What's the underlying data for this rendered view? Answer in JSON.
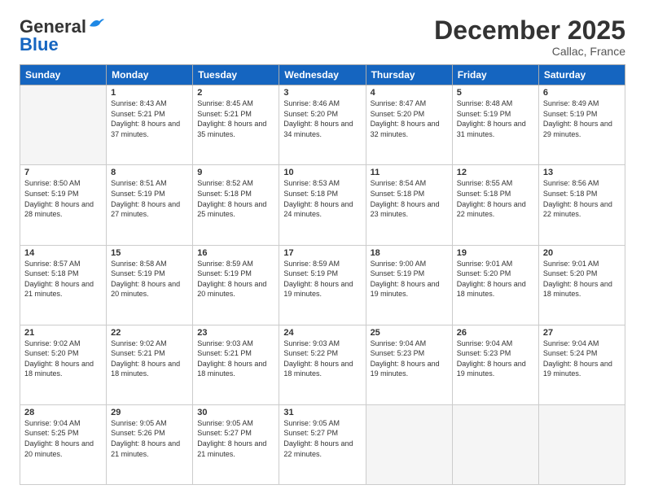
{
  "logo": {
    "line1": "General",
    "line2": "Blue"
  },
  "title": "December 2025",
  "location": "Callac, France",
  "days_header": [
    "Sunday",
    "Monday",
    "Tuesday",
    "Wednesday",
    "Thursday",
    "Friday",
    "Saturday"
  ],
  "weeks": [
    [
      {
        "num": "",
        "empty": true
      },
      {
        "num": "1",
        "sunrise": "8:43 AM",
        "sunset": "5:21 PM",
        "daylight": "8 hours and 37 minutes."
      },
      {
        "num": "2",
        "sunrise": "8:45 AM",
        "sunset": "5:21 PM",
        "daylight": "8 hours and 35 minutes."
      },
      {
        "num": "3",
        "sunrise": "8:46 AM",
        "sunset": "5:20 PM",
        "daylight": "8 hours and 34 minutes."
      },
      {
        "num": "4",
        "sunrise": "8:47 AM",
        "sunset": "5:20 PM",
        "daylight": "8 hours and 32 minutes."
      },
      {
        "num": "5",
        "sunrise": "8:48 AM",
        "sunset": "5:19 PM",
        "daylight": "8 hours and 31 minutes."
      },
      {
        "num": "6",
        "sunrise": "8:49 AM",
        "sunset": "5:19 PM",
        "daylight": "8 hours and 29 minutes."
      }
    ],
    [
      {
        "num": "7",
        "sunrise": "8:50 AM",
        "sunset": "5:19 PM",
        "daylight": "8 hours and 28 minutes."
      },
      {
        "num": "8",
        "sunrise": "8:51 AM",
        "sunset": "5:19 PM",
        "daylight": "8 hours and 27 minutes."
      },
      {
        "num": "9",
        "sunrise": "8:52 AM",
        "sunset": "5:18 PM",
        "daylight": "8 hours and 25 minutes."
      },
      {
        "num": "10",
        "sunrise": "8:53 AM",
        "sunset": "5:18 PM",
        "daylight": "8 hours and 24 minutes."
      },
      {
        "num": "11",
        "sunrise": "8:54 AM",
        "sunset": "5:18 PM",
        "daylight": "8 hours and 23 minutes."
      },
      {
        "num": "12",
        "sunrise": "8:55 AM",
        "sunset": "5:18 PM",
        "daylight": "8 hours and 22 minutes."
      },
      {
        "num": "13",
        "sunrise": "8:56 AM",
        "sunset": "5:18 PM",
        "daylight": "8 hours and 22 minutes."
      }
    ],
    [
      {
        "num": "14",
        "sunrise": "8:57 AM",
        "sunset": "5:18 PM",
        "daylight": "8 hours and 21 minutes."
      },
      {
        "num": "15",
        "sunrise": "8:58 AM",
        "sunset": "5:19 PM",
        "daylight": "8 hours and 20 minutes."
      },
      {
        "num": "16",
        "sunrise": "8:59 AM",
        "sunset": "5:19 PM",
        "daylight": "8 hours and 20 minutes."
      },
      {
        "num": "17",
        "sunrise": "8:59 AM",
        "sunset": "5:19 PM",
        "daylight": "8 hours and 19 minutes."
      },
      {
        "num": "18",
        "sunrise": "9:00 AM",
        "sunset": "5:19 PM",
        "daylight": "8 hours and 19 minutes."
      },
      {
        "num": "19",
        "sunrise": "9:01 AM",
        "sunset": "5:20 PM",
        "daylight": "8 hours and 18 minutes."
      },
      {
        "num": "20",
        "sunrise": "9:01 AM",
        "sunset": "5:20 PM",
        "daylight": "8 hours and 18 minutes."
      }
    ],
    [
      {
        "num": "21",
        "sunrise": "9:02 AM",
        "sunset": "5:20 PM",
        "daylight": "8 hours and 18 minutes."
      },
      {
        "num": "22",
        "sunrise": "9:02 AM",
        "sunset": "5:21 PM",
        "daylight": "8 hours and 18 minutes."
      },
      {
        "num": "23",
        "sunrise": "9:03 AM",
        "sunset": "5:21 PM",
        "daylight": "8 hours and 18 minutes."
      },
      {
        "num": "24",
        "sunrise": "9:03 AM",
        "sunset": "5:22 PM",
        "daylight": "8 hours and 18 minutes."
      },
      {
        "num": "25",
        "sunrise": "9:04 AM",
        "sunset": "5:23 PM",
        "daylight": "8 hours and 19 minutes."
      },
      {
        "num": "26",
        "sunrise": "9:04 AM",
        "sunset": "5:23 PM",
        "daylight": "8 hours and 19 minutes."
      },
      {
        "num": "27",
        "sunrise": "9:04 AM",
        "sunset": "5:24 PM",
        "daylight": "8 hours and 19 minutes."
      }
    ],
    [
      {
        "num": "28",
        "sunrise": "9:04 AM",
        "sunset": "5:25 PM",
        "daylight": "8 hours and 20 minutes."
      },
      {
        "num": "29",
        "sunrise": "9:05 AM",
        "sunset": "5:26 PM",
        "daylight": "8 hours and 21 minutes."
      },
      {
        "num": "30",
        "sunrise": "9:05 AM",
        "sunset": "5:27 PM",
        "daylight": "8 hours and 21 minutes."
      },
      {
        "num": "31",
        "sunrise": "9:05 AM",
        "sunset": "5:27 PM",
        "daylight": "8 hours and 22 minutes."
      },
      {
        "num": "",
        "empty": true
      },
      {
        "num": "",
        "empty": true
      },
      {
        "num": "",
        "empty": true
      }
    ]
  ]
}
